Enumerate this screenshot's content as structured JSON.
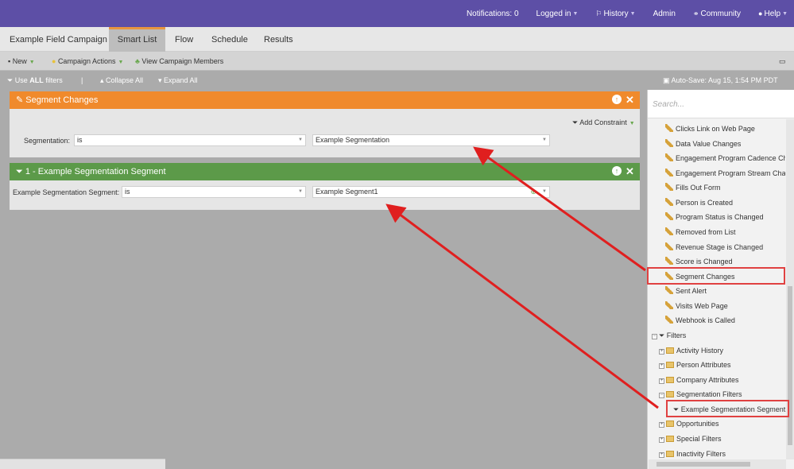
{
  "topnav": {
    "notifications": "Notifications: 0",
    "logged_in": "Logged in",
    "history": "History",
    "admin": "Admin",
    "community": "Community",
    "help": "Help"
  },
  "tabs": {
    "campaign": "Example Field Campaign",
    "smart_list": "Smart List",
    "flow": "Flow",
    "schedule": "Schedule",
    "results": "Results"
  },
  "toolbar": {
    "new": "New",
    "campaign_actions": "Campaign Actions",
    "view_members": "View Campaign Members"
  },
  "subbar": {
    "use": "Use ",
    "all": "ALL",
    "filters": " filters",
    "separator": "|",
    "collapse": "Collapse All",
    "expand": "Expand All",
    "autosave": "Auto-Save: Aug 15, 1:54 PM PDT"
  },
  "card1": {
    "title": "Segment Changes",
    "add_constraint": "Add Constraint",
    "label": "Segmentation:",
    "operator": "is",
    "value": "Example Segmentation"
  },
  "card2": {
    "title": "1 - Example Segmentation Segment",
    "label": "Example Segmentation Segment:",
    "operator": "is",
    "value": "Example Segment1"
  },
  "panel": {
    "search_placeholder": "Search...",
    "triggers": [
      "Clicks Link on Web Page",
      "Data Value Changes",
      "Engagement Program Cadence Changes",
      "Engagement Program Stream Changes",
      "Fills Out Form",
      "Person is Created",
      "Program Status is Changed",
      "Removed from List",
      "Revenue Stage is Changed",
      "Score is Changed",
      "Segment Changes",
      "Sent Alert",
      "Visits Web Page",
      "Webhook is Called"
    ],
    "filters_label": "Filters",
    "filter_groups": [
      "Activity History",
      "Person Attributes",
      "Company Attributes",
      "Segmentation Filters"
    ],
    "segment_filter": "Example Segmentation Segment",
    "filter_groups_after": [
      "Opportunities",
      "Special Filters",
      "Inactivity Filters"
    ]
  },
  "colors": {
    "topbar": "#5d4fa6",
    "trigger_header": "#f08a2c",
    "filter_header": "#5c9a49",
    "annotation": "#e01f1f"
  }
}
